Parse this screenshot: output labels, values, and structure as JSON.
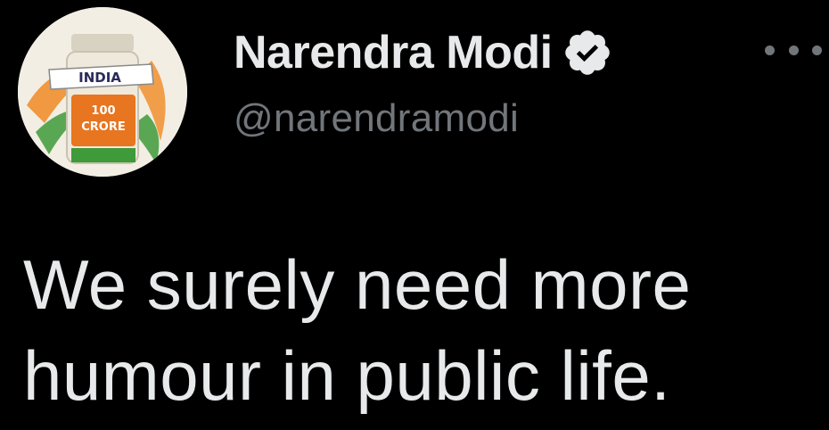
{
  "author": {
    "display_name": "Narendra Modi",
    "handle": "@narendramodi",
    "verified": true,
    "avatar_badge": {
      "country": "INDIA",
      "line1": "100",
      "line2": "CRORE"
    }
  },
  "tweet": {
    "text": "We surely need more\nhumour in public life."
  },
  "icons": {
    "verified": "verified-badge-icon",
    "more": "more-options-icon"
  },
  "colors": {
    "background": "#000000",
    "primary_text": "#e7e9ea",
    "secondary_text": "#71767b",
    "verified_badge": "#e7e9ea"
  }
}
